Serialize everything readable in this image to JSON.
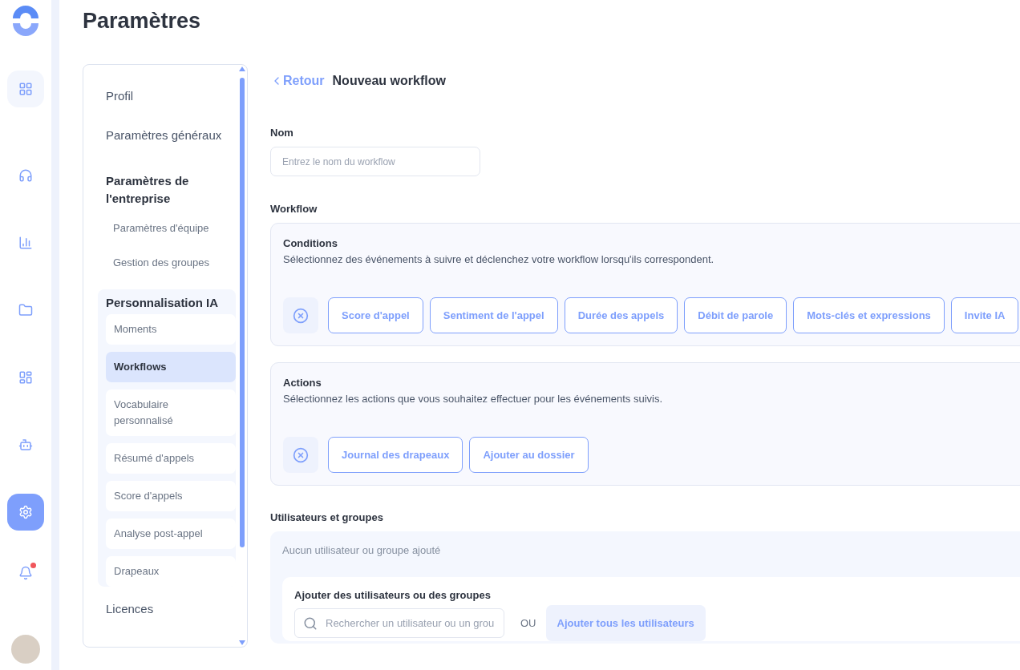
{
  "rail": [
    {
      "kind": "logo"
    },
    {
      "kind": "grid",
      "selected": false,
      "hovered": true,
      "badge": false
    },
    {
      "kind": "headphones",
      "selected": false,
      "hovered": false,
      "badge": false
    },
    {
      "kind": "chart",
      "selected": false,
      "hovered": false,
      "badge": false
    },
    {
      "kind": "folder",
      "selected": false,
      "hovered": false,
      "badge": false
    },
    {
      "kind": "widgets",
      "selected": false,
      "hovered": false,
      "badge": false
    },
    {
      "kind": "bot",
      "selected": false,
      "hovered": false,
      "badge": false
    },
    {
      "kind": "settings",
      "selected": true,
      "hovered": false,
      "badge": false
    },
    {
      "kind": "bell",
      "selected": false,
      "hovered": false,
      "badge": true
    },
    {
      "kind": "avatar"
    }
  ],
  "page_title": "Paramètres",
  "settings_nav": [
    {
      "kind": "link",
      "label": "Profil"
    },
    {
      "kind": "link",
      "label": "Paramètres généraux"
    },
    {
      "kind": "section",
      "label": "Paramètres de l'entreprise",
      "children": [
        {
          "label": "Paramètres d'équipe"
        },
        {
          "label": "Gestion des groupes"
        }
      ]
    },
    {
      "kind": "group",
      "label": "Personnalisation IA",
      "children": [
        {
          "label": "Moments",
          "selected": false
        },
        {
          "label": "Workflows",
          "selected": true
        },
        {
          "label": "Vocabulaire personnalisé",
          "selected": false
        },
        {
          "label": "Résumé d'appels",
          "selected": false
        },
        {
          "label": "Score d'appels",
          "selected": false
        },
        {
          "label": "Analyse post-appel",
          "selected": false
        },
        {
          "label": "Drapeaux",
          "selected": false
        }
      ]
    },
    {
      "kind": "link",
      "label": "Licences"
    }
  ],
  "header": {
    "back": "Retour",
    "title": "Nouveau workflow"
  },
  "name_field": {
    "label": "Nom",
    "placeholder": "Entrez le nom du workflow"
  },
  "workflow_label": "Workflow",
  "blocks": [
    {
      "title": "Conditions",
      "description": "Sélectionnez des événements à suivre et déclenchez votre workflow lorsqu'ils correspondent.",
      "options": [
        "Score d'appel",
        "Sentiment de l'appel",
        "Durée des appels",
        "Débit de parole",
        "Mots-clés et expressions",
        "Invite IA"
      ]
    },
    {
      "title": "Actions",
      "description": "Sélectionnez les actions que vous souhaitez effectuer pour les événements suivis.",
      "options": [
        "Journal des drapeaux",
        "Ajouter au dossier"
      ]
    }
  ],
  "users": {
    "label": "Utilisateurs et groupes",
    "empty": "Aucun utilisateur ou groupe ajouté",
    "add_title": "Ajouter des utilisateurs ou des groupes",
    "search_placeholder": "Rechercher un utilisateur ou un grou",
    "or": "OU",
    "add_all": "Ajouter tous les utilisateurs"
  }
}
